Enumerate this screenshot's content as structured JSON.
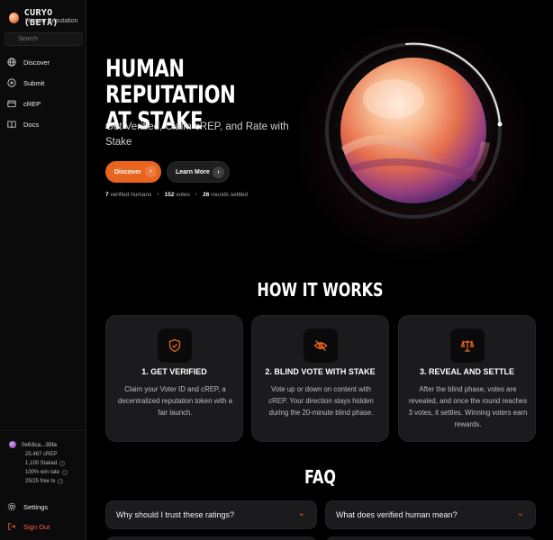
{
  "brand": {
    "title": "CURYO (BETA)",
    "subtitle": "Human Reputation"
  },
  "search": {
    "placeholder": "Search"
  },
  "nav": [
    {
      "label": "Discover",
      "icon": "globe-icon"
    },
    {
      "label": "Submit",
      "icon": "plus-circle-icon"
    },
    {
      "label": "cREP",
      "icon": "wallet-icon"
    },
    {
      "label": "Docs",
      "icon": "book-icon"
    }
  ],
  "wallet": {
    "address": "0x63ca...35fa",
    "balance": "25.467 cREP",
    "staked": "1,100  Staked",
    "win_rate": "100%  win rate",
    "free_tx": "25/25  free tx"
  },
  "footer_nav": {
    "settings": "Settings",
    "signout": "Sign Out"
  },
  "hero": {
    "title_line1": "HUMAN REPUTATION",
    "title_line2": "AT STAKE",
    "subtitle": "Get Verified, Claim cREP, and Rate with Stake",
    "btn_discover": "Discover",
    "btn_learn": "Learn More",
    "stats": {
      "humans_value": "7",
      "humans_label": "verified humans",
      "votes_value": "152",
      "votes_label": "votes",
      "rounds_value": "26",
      "rounds_label": "rounds settled"
    }
  },
  "how": {
    "title": "HOW IT WORKS",
    "cards": [
      {
        "title": "1. GET VERIFIED",
        "body": "Claim your Voter ID and cREP, a decentralized reputation token with a fair launch.",
        "icon": "shield-check-icon"
      },
      {
        "title": "2. BLIND VOTE WITH STAKE",
        "body": "Vote up or down on content with cREP. Your direction stays hidden during the 20-minute blind phase.",
        "icon": "eye-off-icon"
      },
      {
        "title": "3. REVEAL AND SETTLE",
        "body": "After the blind phase, votes are revealed, and once the round reaches 3 votes, it settles. Winning voters earn rewards.",
        "icon": "scale-icon"
      }
    ]
  },
  "faq": {
    "title": "FAQ",
    "items": [
      {
        "question": "Why should I trust these ratings?"
      },
      {
        "question": "What does verified human mean?"
      }
    ]
  },
  "colors": {
    "accent": "#e8641f",
    "background": "#000000",
    "card": "#1b1b1d",
    "danger": "#ff5b4d"
  }
}
